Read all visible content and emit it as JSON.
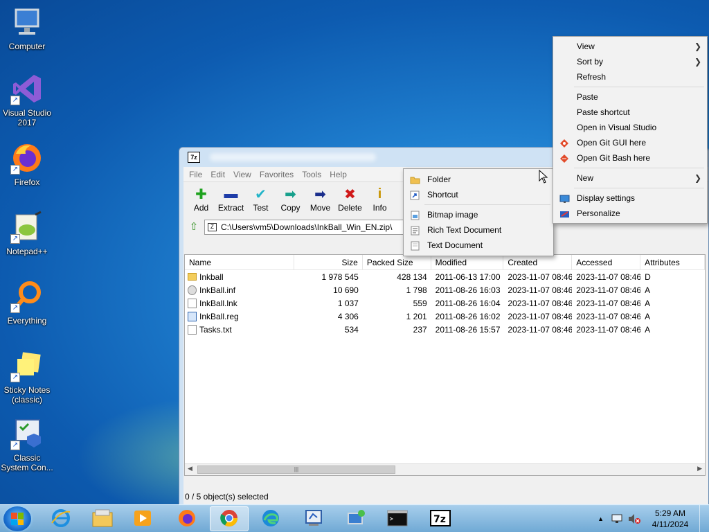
{
  "desktop": {
    "icons": [
      {
        "label": "Computer",
        "icon": "computer-icon"
      },
      {
        "label": "Visual Studio 2017",
        "icon": "visual-studio-icon"
      },
      {
        "label": "Firefox",
        "icon": "firefox-icon"
      },
      {
        "label": "Notepad++",
        "icon": "notepad-plus-plus-icon"
      },
      {
        "label": "Everything",
        "icon": "everything-search-icon"
      },
      {
        "label": "Sticky Notes (classic)",
        "icon": "sticky-notes-icon"
      },
      {
        "label": "Classic System Con...",
        "icon": "control-panel-icon"
      }
    ]
  },
  "window": {
    "app_icon_text": "7z",
    "menu": [
      "File",
      "Edit",
      "View",
      "Favorites",
      "Tools",
      "Help"
    ],
    "toolbar": [
      {
        "label": "Add",
        "icon": "add-icon",
        "glyph": "✚",
        "color": "#1ea21e"
      },
      {
        "label": "Extract",
        "icon": "extract-icon",
        "glyph": "▬",
        "color": "#1e3ca8"
      },
      {
        "label": "Test",
        "icon": "test-icon",
        "glyph": "✔",
        "color": "#22b4c8"
      },
      {
        "label": "Copy",
        "icon": "copy-icon",
        "glyph": "➡",
        "color": "#17a08c"
      },
      {
        "label": "Move",
        "icon": "move-icon",
        "glyph": "➡",
        "color": "#1a2e8c"
      },
      {
        "label": "Delete",
        "icon": "delete-icon",
        "glyph": "✖",
        "color": "#d01818"
      },
      {
        "label": "Info",
        "icon": "info-icon",
        "glyph": "i",
        "color": "#c89400"
      }
    ],
    "path": "C:\\Users\\vm5\\Downloads\\InkBall_Win_EN.zip\\",
    "columns": [
      "Name",
      "Size",
      "Packed Size",
      "Modified",
      "Created",
      "Accessed",
      "Attributes"
    ],
    "rows": [
      {
        "name": "Inkball",
        "type": "folder",
        "size": "1 978 545",
        "packed": "428 134",
        "modified": "2011-06-13 17:00",
        "created": "2023-11-07 08:46",
        "accessed": "2023-11-07 08:46",
        "attr": "D"
      },
      {
        "name": "InkBall.inf",
        "type": "gear",
        "size": "10 690",
        "packed": "1 798",
        "modified": "2011-08-26 16:03",
        "created": "2023-11-07 08:46",
        "accessed": "2023-11-07 08:46",
        "attr": "A"
      },
      {
        "name": "InkBall.lnk",
        "type": "file",
        "size": "1 037",
        "packed": "559",
        "modified": "2011-08-26 16:04",
        "created": "2023-11-07 08:46",
        "accessed": "2023-11-07 08:46",
        "attr": "A"
      },
      {
        "name": "InkBall.reg",
        "type": "reg",
        "size": "4 306",
        "packed": "1 201",
        "modified": "2011-08-26 16:02",
        "created": "2023-11-07 08:46",
        "accessed": "2023-11-07 08:46",
        "attr": "A"
      },
      {
        "name": "Tasks.txt",
        "type": "file",
        "size": "534",
        "packed": "237",
        "modified": "2011-08-26 15:57",
        "created": "2023-11-07 08:46",
        "accessed": "2023-11-07 08:46",
        "attr": "A"
      }
    ],
    "status": "0 / 5 object(s) selected"
  },
  "context_menu": {
    "items": [
      {
        "label": "View",
        "submenu": true
      },
      {
        "label": "Sort by",
        "submenu": true
      },
      {
        "label": "Refresh"
      },
      {
        "sep": true
      },
      {
        "label": "Paste"
      },
      {
        "label": "Paste shortcut"
      },
      {
        "label": "Open in Visual Studio"
      },
      {
        "label": "Open Git GUI here",
        "icon": "git-gui-icon"
      },
      {
        "label": "Open Git Bash here",
        "icon": "git-bash-icon"
      },
      {
        "sep": true
      },
      {
        "label": "New",
        "submenu": true
      },
      {
        "sep": true
      },
      {
        "label": "Display settings",
        "icon": "display-settings-icon"
      },
      {
        "label": "Personalize",
        "icon": "personalize-icon"
      }
    ]
  },
  "new_submenu": {
    "items": [
      {
        "label": "Folder",
        "icon": "folder-icon"
      },
      {
        "label": "Shortcut",
        "icon": "shortcut-icon"
      },
      {
        "sep": true
      },
      {
        "label": "Bitmap image",
        "icon": "bitmap-icon"
      },
      {
        "label": "Rich Text Document",
        "icon": "rich-text-icon"
      },
      {
        "label": "Text Document",
        "icon": "text-document-icon"
      }
    ]
  },
  "taskbar": {
    "apps": [
      {
        "name": "internet-explorer",
        "icon": "internet-explorer-icon"
      },
      {
        "name": "file-explorer",
        "icon": "file-explorer-icon"
      },
      {
        "name": "media-player",
        "icon": "media-player-icon"
      },
      {
        "name": "firefox",
        "icon": "firefox-icon"
      },
      {
        "name": "chrome",
        "icon": "chrome-icon",
        "active": true
      },
      {
        "name": "edge",
        "icon": "edge-icon"
      },
      {
        "name": "system-configuration",
        "icon": "system-config-icon"
      },
      {
        "name": "remote-desktop",
        "icon": "remote-desktop-icon"
      },
      {
        "name": "command-prompt",
        "icon": "command-prompt-icon"
      },
      {
        "name": "7zip",
        "icon": "7zip-icon"
      }
    ],
    "time": "5:29 AM",
    "date": "4/11/2024"
  }
}
